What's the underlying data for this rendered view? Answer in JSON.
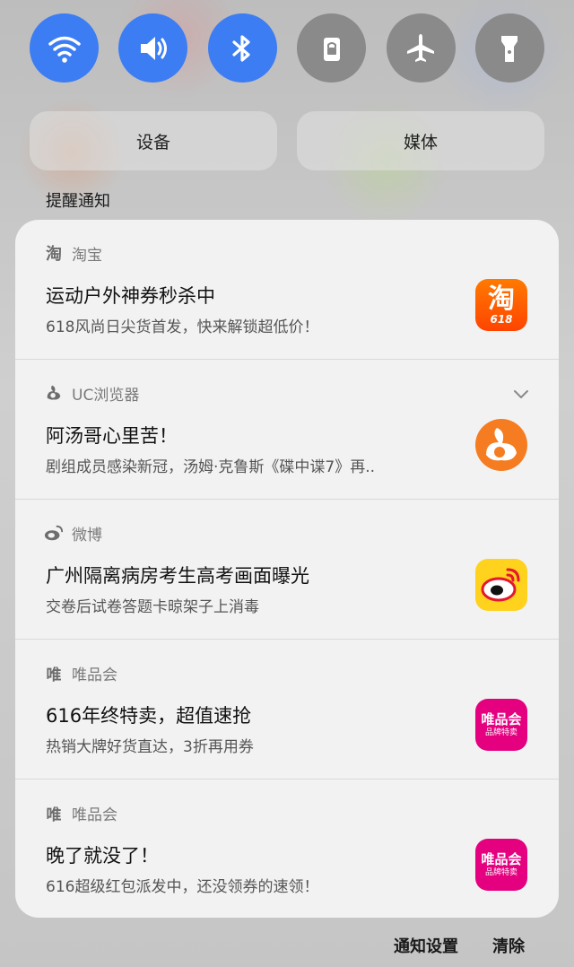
{
  "quick_toggles": [
    {
      "name": "wifi-icon",
      "state": "on"
    },
    {
      "name": "volume-icon",
      "state": "on"
    },
    {
      "name": "bluetooth-icon",
      "state": "on"
    },
    {
      "name": "lock-icon",
      "state": "off"
    },
    {
      "name": "airplane-icon",
      "state": "off"
    },
    {
      "name": "flashlight-icon",
      "state": "off"
    }
  ],
  "colors": {
    "accent": "#3c7df3",
    "off": "#8a8a8a",
    "taobao": "#ff5a00",
    "uc": "#f57c20",
    "weibo": "#e6162d",
    "vip": "#e4007f"
  },
  "segments": {
    "devices": "设备",
    "media": "媒体"
  },
  "section_title": "提醒通知",
  "notifications": [
    {
      "app": "淘宝",
      "app_glyph": "淘",
      "title": "运动户外神券秒杀中",
      "body": "618风尚日尖货首发，快来解锁超低价！",
      "icon_text": "淘",
      "icon_subtext": "618"
    },
    {
      "app": "UC浏览器",
      "title": "阿汤哥心里苦！",
      "body": "剧组成员感染新冠，汤姆·克鲁斯《碟中谍7》再..",
      "expandable": true
    },
    {
      "app": "微博",
      "title": "广州隔离病房考生高考画面曝光",
      "body": "交卷后试卷答题卡晾架子上消毒"
    },
    {
      "app": "唯品会",
      "app_glyph": "唯",
      "title": "616年终特卖，超值速抢",
      "body": "热销大牌好货直达，3折再用券",
      "icon_text": "唯品会",
      "icon_subtext": "品牌特卖"
    },
    {
      "app": "唯品会",
      "app_glyph": "唯",
      "title": "晚了就没了！",
      "body": "616超级红包派发中，还没领券的速领！",
      "icon_text": "唯品会",
      "icon_subtext": "品牌特卖"
    }
  ],
  "footer": {
    "settings": "通知设置",
    "clear": "清除"
  }
}
